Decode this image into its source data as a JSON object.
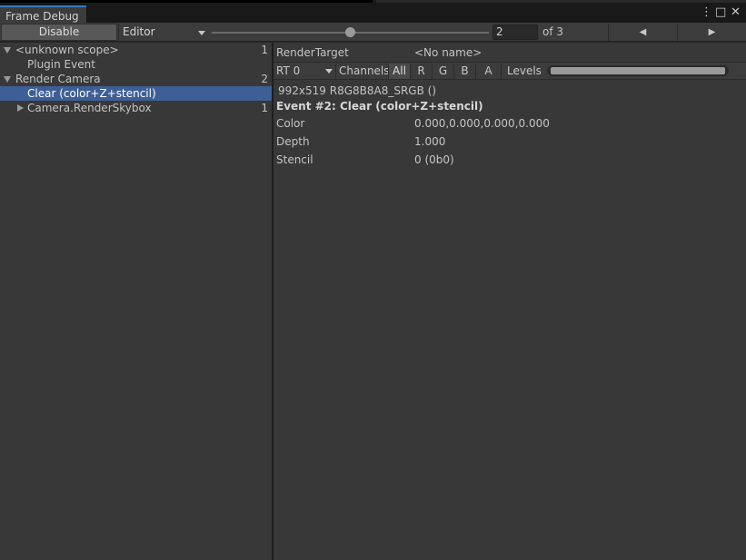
{
  "window": {
    "tab_title": "Frame Debug",
    "menu_glyph": "⋮",
    "maximize_glyph": "□",
    "close_glyph": "✕"
  },
  "toolbar": {
    "disable_label": "Disable",
    "target_value": "Editor",
    "frame_value": "2",
    "frame_total": "of 3",
    "prev_glyph": "◀",
    "next_glyph": "▶",
    "slider_fraction": 0.5
  },
  "tree": {
    "items": [
      {
        "label": "<unknown scope>",
        "count": "1",
        "expand": "down",
        "depth": 0
      },
      {
        "label": "Plugin Event",
        "count": "",
        "expand": "none",
        "depth": 1
      },
      {
        "label": "Render Camera",
        "count": "2",
        "expand": "down",
        "depth": 0
      },
      {
        "label": "Clear (color+Z+stencil)",
        "count": "",
        "expand": "none",
        "depth": 1,
        "selected": true
      },
      {
        "label": "Camera.RenderSkybox",
        "count": "1",
        "expand": "right",
        "depth": 1
      }
    ]
  },
  "details": {
    "render_target_label": "RenderTarget",
    "render_target_value": "<No name>",
    "rt_value": "RT 0",
    "channels_label": "Channels",
    "channels": [
      "All",
      "R",
      "G",
      "B",
      "A"
    ],
    "active_channel": "All",
    "levels_label": "Levels",
    "format": "992x519 R8G8B8A8_SRGB ()",
    "event_title": "Event #2: Clear (color+Z+stencil)",
    "props": [
      {
        "name": "Color",
        "value": "0.000,0.000,0.000,0.000"
      },
      {
        "name": "Depth",
        "value": "1.000"
      },
      {
        "name": "Stencil",
        "value": "0 (0b0)"
      }
    ]
  },
  "colors": {
    "selection": "#3e5f96",
    "panel": "#383838",
    "tab_accent": "#3a79bb"
  }
}
